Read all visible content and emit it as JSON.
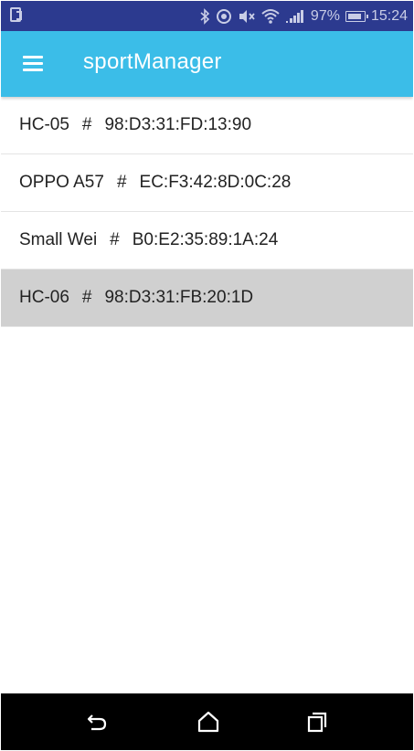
{
  "status_bar": {
    "battery_percent": "97%",
    "time": "15:24",
    "color": "#2c3a8f",
    "icons": [
      "screen-rotate-icon",
      "bluetooth-icon",
      "target-icon",
      "mute-icon",
      "wifi-icon",
      "signal-icon",
      "battery-icon"
    ]
  },
  "app_bar": {
    "title": "sportManager",
    "color": "#3bbde8",
    "menu_icon": "hamburger-menu-icon"
  },
  "devices": [
    {
      "name": "HC-05",
      "separator": "#",
      "address": "98:D3:31:FD:13:90",
      "selected": false
    },
    {
      "name": "OPPO A57",
      "separator": "#",
      "address": "EC:F3:42:8D:0C:28",
      "selected": false
    },
    {
      "name": "Small Wei",
      "separator": "#",
      "address": "B0:E2:35:89:1A:24",
      "selected": false
    },
    {
      "name": "HC-06",
      "separator": "#",
      "address": "98:D3:31:FB:20:1D",
      "selected": true
    }
  ],
  "nav_bar": {
    "buttons": [
      "back-icon",
      "home-icon",
      "recent-apps-icon"
    ]
  }
}
